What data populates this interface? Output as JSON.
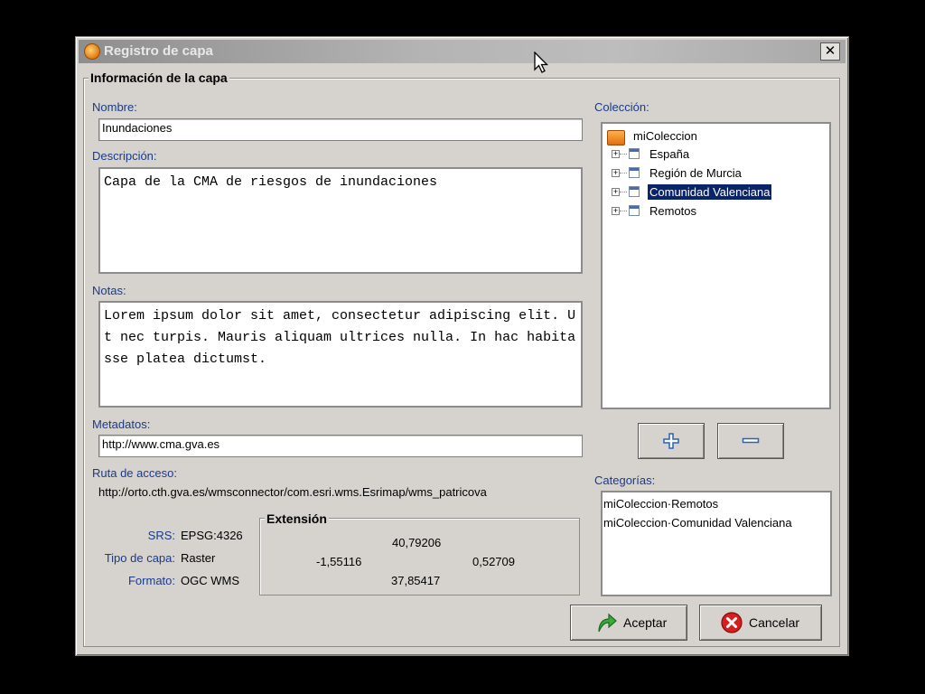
{
  "window": {
    "title": "Registro de capa",
    "close_glyph": "✕"
  },
  "group": {
    "legend": "Información de la capa"
  },
  "form": {
    "nombre_label": "Nombre:",
    "nombre_value": "Inundaciones",
    "descripcion_label": "Descripción:",
    "descripcion_value": "Capa de la CMA de riesgos de inundaciones",
    "notas_label": "Notas:",
    "notas_value": "Lorem ipsum dolor sit amet, consectetur adipiscing elit. Ut nec turpis. Mauris aliquam ultrices nulla. In hac habitasse platea dictumst.",
    "metadatos_label": "Metadatos:",
    "metadatos_value": "http://www.cma.gva.es",
    "ruta_label": "Ruta de acceso:",
    "ruta_value": "http://orto.cth.gva.es/wmsconnector/com.esri.wms.Esrimap/wms_patricova"
  },
  "info": {
    "srs_label": "SRS:",
    "srs_value": "EPSG:4326",
    "tipo_label": "Tipo de capa:",
    "tipo_value": "Raster",
    "formato_label": "Formato:",
    "formato_value": "OGC WMS"
  },
  "extension": {
    "legend": "Extensión",
    "north": "40,79206",
    "west": "-1,55116",
    "east": "0,52709",
    "south": "37,85417"
  },
  "coleccion": {
    "label": "Colección:",
    "root": "miColeccion",
    "items": [
      {
        "label": "España",
        "selected": false
      },
      {
        "label": "Región de Murcia",
        "selected": false
      },
      {
        "label": "Comunidad Valenciana",
        "selected": true
      },
      {
        "label": "Remotos",
        "selected": false
      }
    ]
  },
  "categorias": {
    "label": "Categorías:",
    "items": [
      "miColeccion·Remotos",
      "miColeccion·Comunidad Valenciana"
    ]
  },
  "buttons": {
    "add_icon": "plus-icon",
    "remove_icon": "minus-icon",
    "aceptar": "Aceptar",
    "cancelar": "Cancelar"
  },
  "colors": {
    "selection": "#0a246a",
    "label_blue": "#1a3a8a",
    "dialog_bg": "#d6d3ce"
  }
}
